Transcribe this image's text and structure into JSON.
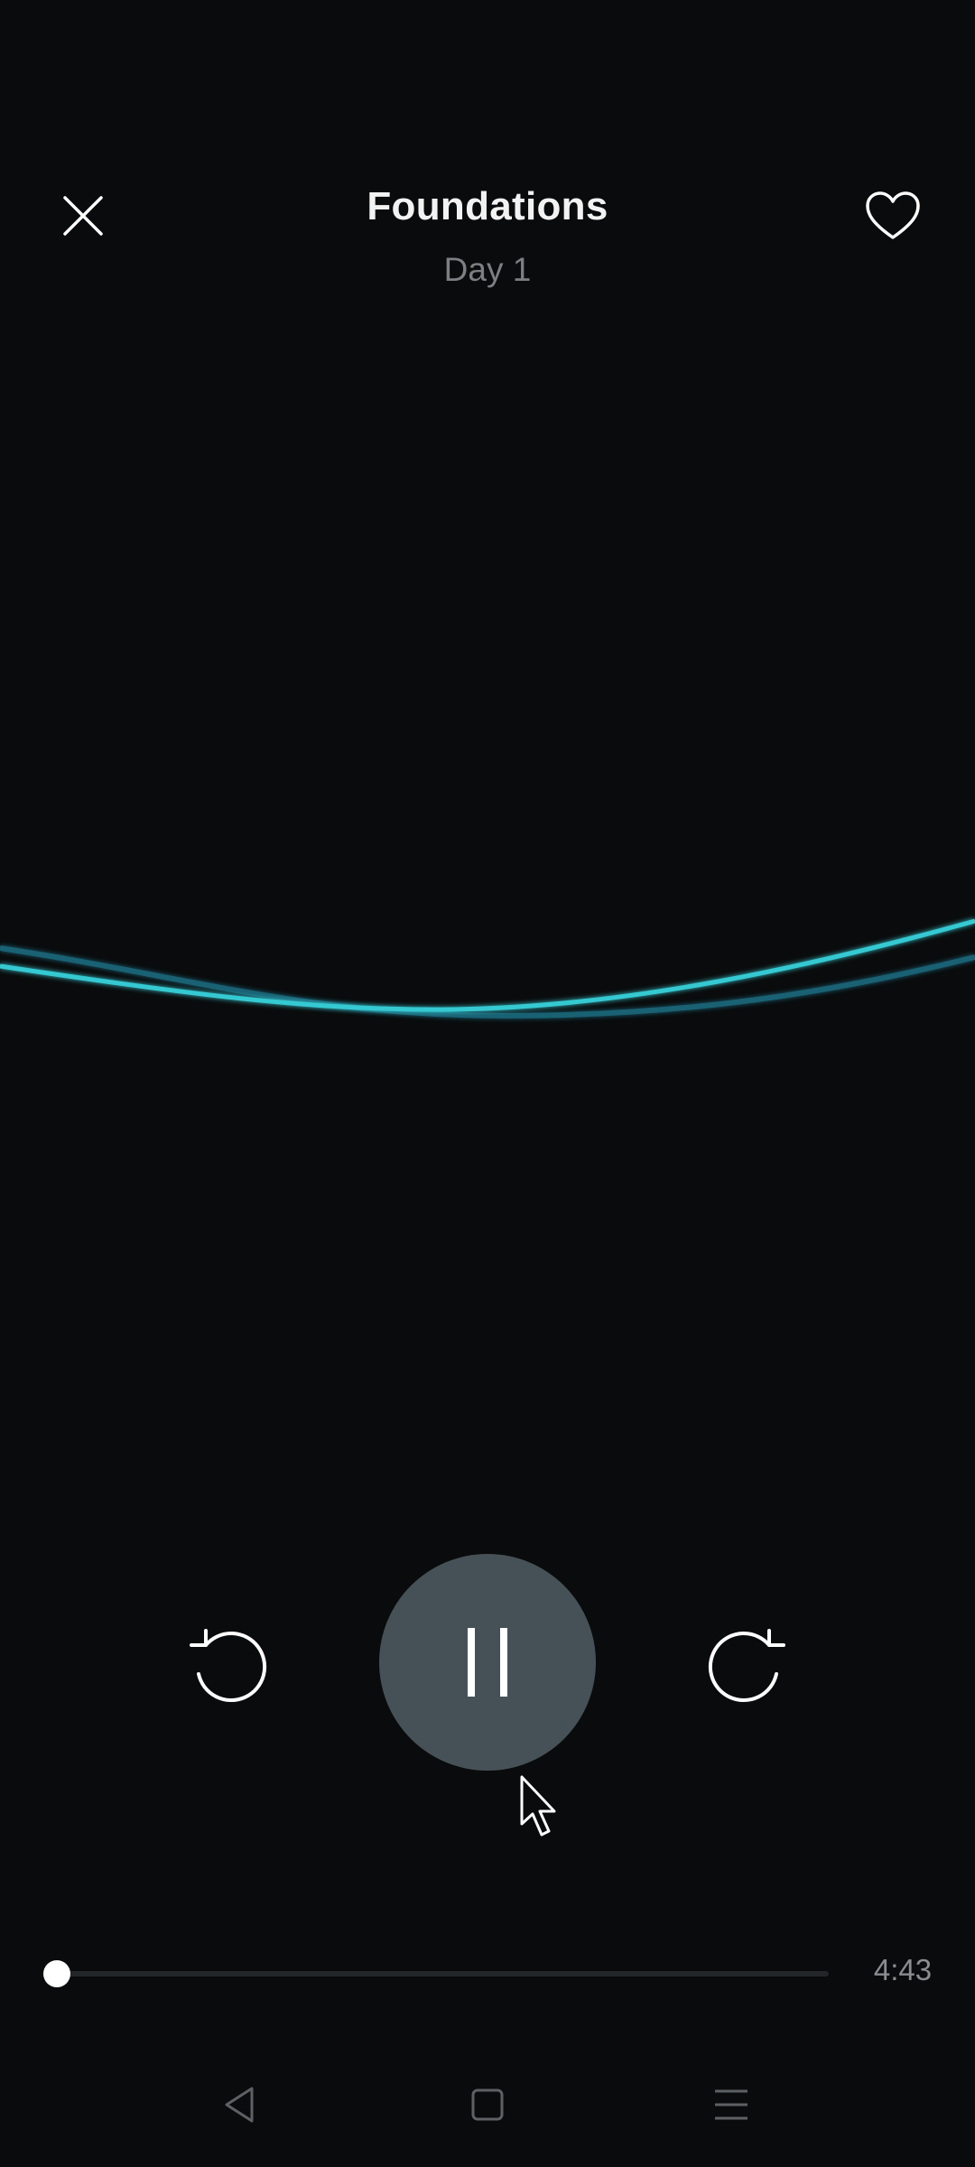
{
  "header": {
    "title": "Foundations",
    "subtitle": "Day 1",
    "close_icon": "close-icon",
    "favorite_icon": "heart-icon"
  },
  "player": {
    "state": "playing",
    "pause_icon": "pause-icon",
    "rewind_icon": "rewind-icon",
    "forward_icon": "forward-icon",
    "progress": 0.0,
    "duration": "4:43"
  },
  "colors": {
    "background": "#0a0b0c",
    "wave_primary": "#36c9d2",
    "wave_secondary": "#1a6f86",
    "pause_button_bg": "#465157",
    "subtitle": "#7c7f83",
    "duration_text": "#8a8d90"
  },
  "system_nav": {
    "back_icon": "nav-back-icon",
    "home_icon": "nav-home-icon",
    "recents_icon": "nav-recents-icon"
  }
}
